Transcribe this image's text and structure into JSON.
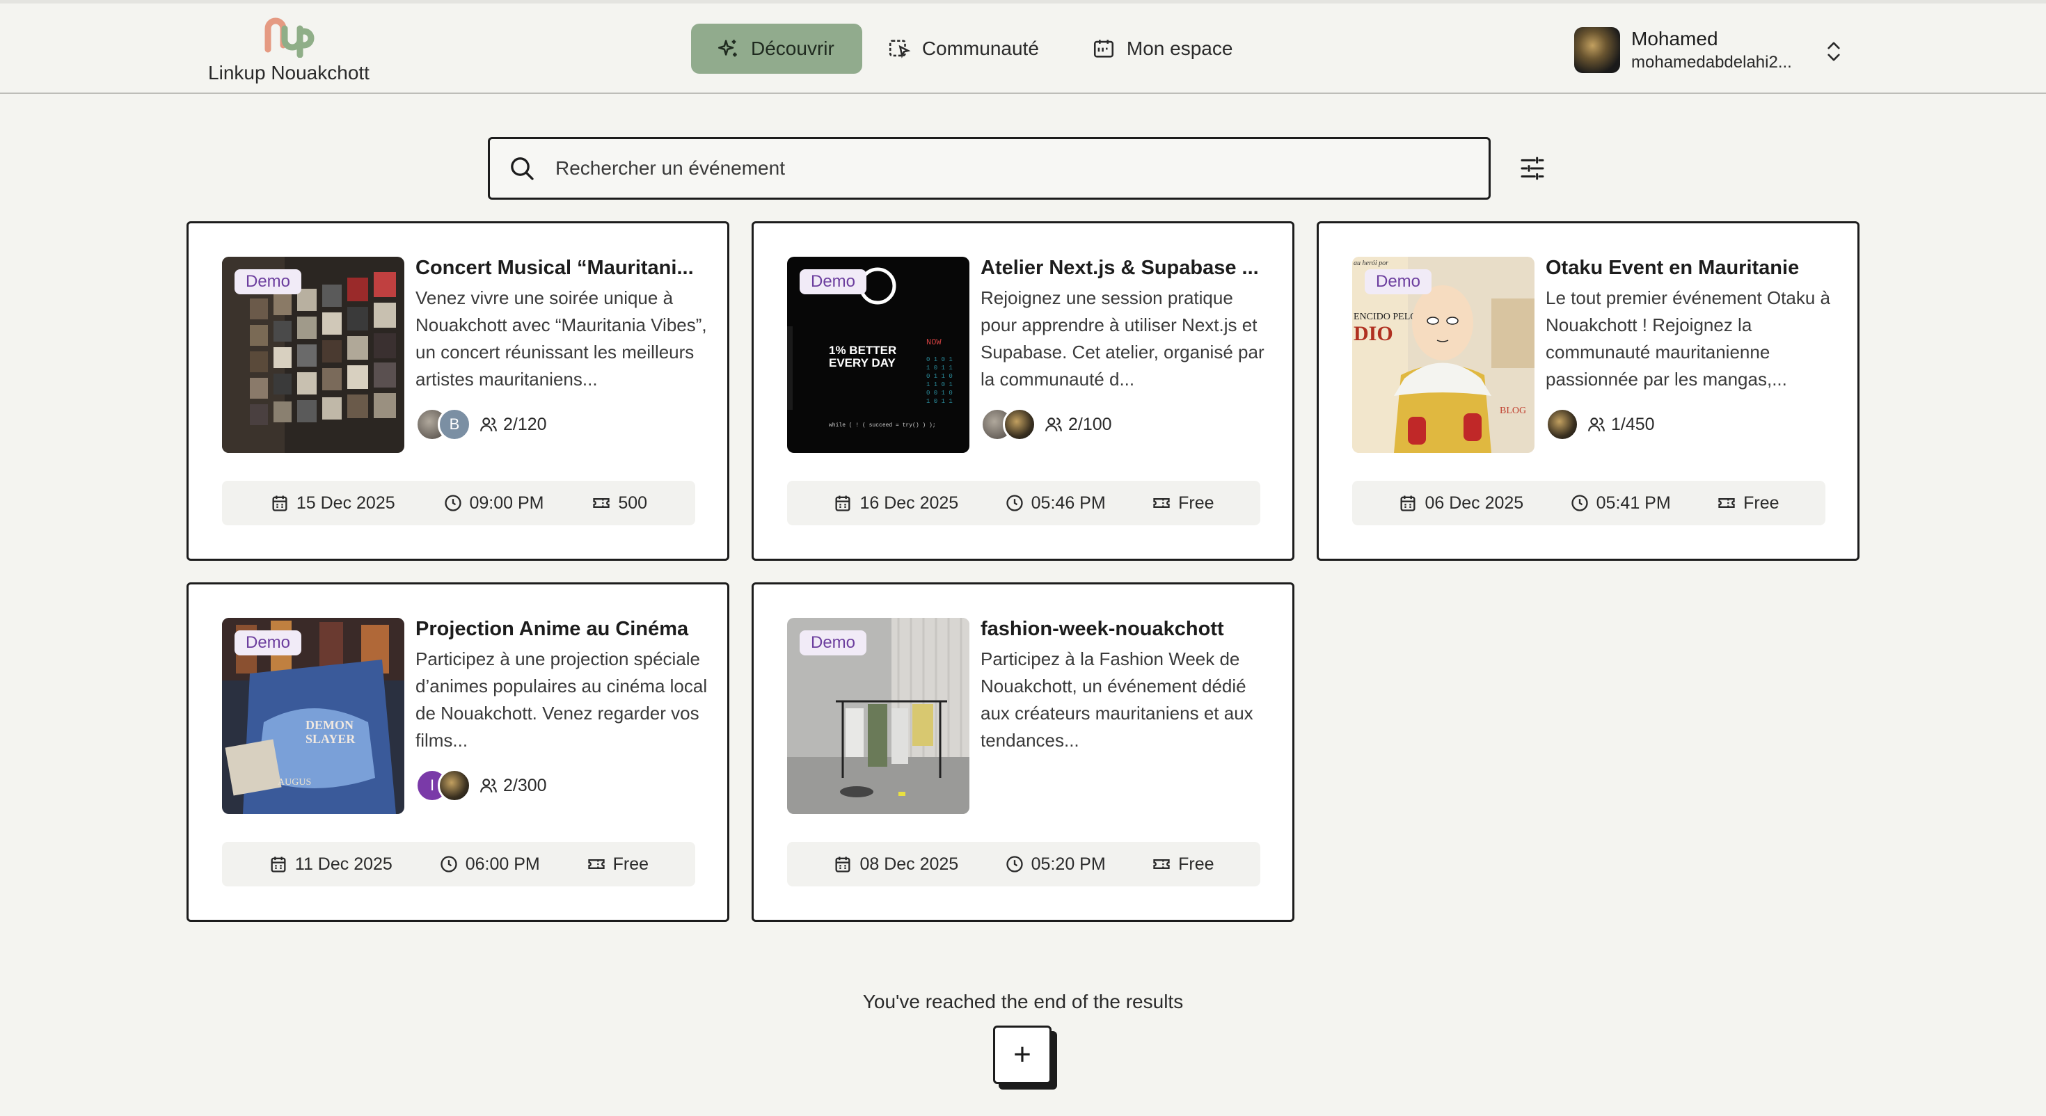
{
  "app": {
    "name": "Linkup Nouakchott"
  },
  "nav": [
    {
      "label": "Découvrir",
      "icon": "sparkles-icon",
      "active": true
    },
    {
      "label": "Communauté",
      "icon": "community-icon",
      "active": false
    },
    {
      "label": "Mon espace",
      "icon": "calendar-icon",
      "active": false
    }
  ],
  "user": {
    "name": "Mohamed",
    "email": "mohamedabdelahi2..."
  },
  "search": {
    "placeholder": "Rechercher un événement"
  },
  "badge_label": "Demo",
  "events": [
    {
      "title": "Concert Musical “Mauritani...",
      "description": "Venez vivre une soirée unique à Nouakchott avec “Mauritania Vibes”, un concert réunissant les meilleurs artistes mauritaniens...",
      "attendee_avatars": [
        "",
        "B"
      ],
      "attendees": "2/120",
      "date": "15 Dec 2025",
      "time": "09:00 PM",
      "price": "500"
    },
    {
      "title": "Atelier Next.js & Supabase ...",
      "description": "Rejoignez une session pratique pour apprendre à utiliser Next.js et Supabase. Cet atelier, organisé par la communauté d...",
      "attendee_avatars": [
        "",
        ""
      ],
      "attendees": "2/100",
      "date": "16 Dec 2025",
      "time": "05:46 PM",
      "price": "Free"
    },
    {
      "title": "Otaku Event en Mauritanie",
      "description": "Le tout premier événement Otaku à Nouakchott ! Rejoignez la communauté mauritanienne passionnée par les mangas,...",
      "attendee_avatars": [
        ""
      ],
      "attendees": "1/450",
      "date": "06 Dec 2025",
      "time": "05:41 PM",
      "price": "Free"
    },
    {
      "title": "Projection Anime au Cinéma",
      "description": "Participez à une projection spéciale d’animes populaires au cinéma local de Nouakchott. Venez regarder vos films...",
      "attendee_avatars": [
        "I",
        ""
      ],
      "attendees": "2/300",
      "date": "11 Dec 2025",
      "time": "06:00 PM",
      "price": "Free"
    },
    {
      "title": "fashion-week-nouakchott",
      "description": "Participez à la Fashion Week de Nouakchott, un événement dédié aux créateurs mauritaniens et aux tendances...",
      "attendee_avatars": [],
      "attendees": "",
      "date": "08 Dec 2025",
      "time": "05:20 PM",
      "price": "Free"
    }
  ],
  "image_texts": {
    "nextjs": [
      "1% BETTER",
      "EVERY DAY",
      "while ( ! ( succeed = try() ) );",
      "NOW"
    ],
    "otaku": [
      "au herói por",
      "ENCIDO PELO",
      "DIO",
      "BLOG"
    ],
    "anime": [
      "DEMON",
      "SLAYER",
      "AUGUS"
    ]
  },
  "footer": {
    "end_text": "You've reached the end of the results",
    "add_label": "+"
  },
  "colors": {
    "active_nav": "#91ab8d",
    "badge_bg": "#f1ebf7",
    "badge_text": "#6c3e9e",
    "background": "#f4f4f0"
  }
}
